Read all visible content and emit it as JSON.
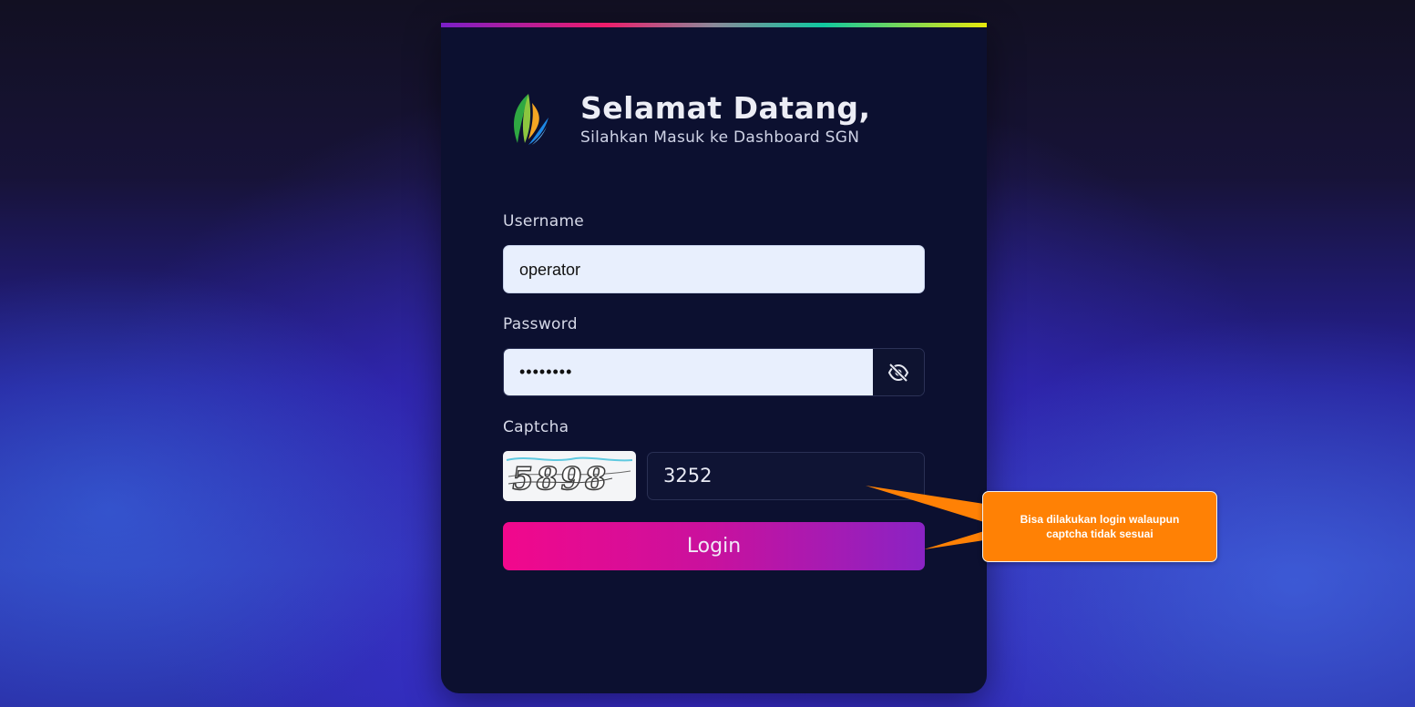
{
  "header": {
    "title": "Selamat Datang,",
    "subtitle": "Silahkan Masuk ke Dashboard SGN",
    "logo_icon": "sgn-leaf-logo-icon"
  },
  "form": {
    "username_label": "Username",
    "username_value": "operator",
    "password_label": "Password",
    "password_value": "••••••••",
    "password_toggle_icon": "eye-slash-icon",
    "captcha_label": "Captcha",
    "captcha_image_text": "5898",
    "captcha_value": "3252",
    "login_label": "Login"
  },
  "annotation": {
    "text": "Bisa dilakukan login walaupun captcha tidak sesuai"
  },
  "colors": {
    "accent_gradient_start": "#f2088c",
    "accent_gradient_end": "#8a23c4",
    "card_bg": "#0c1030",
    "callout_bg": "#ff8105"
  }
}
